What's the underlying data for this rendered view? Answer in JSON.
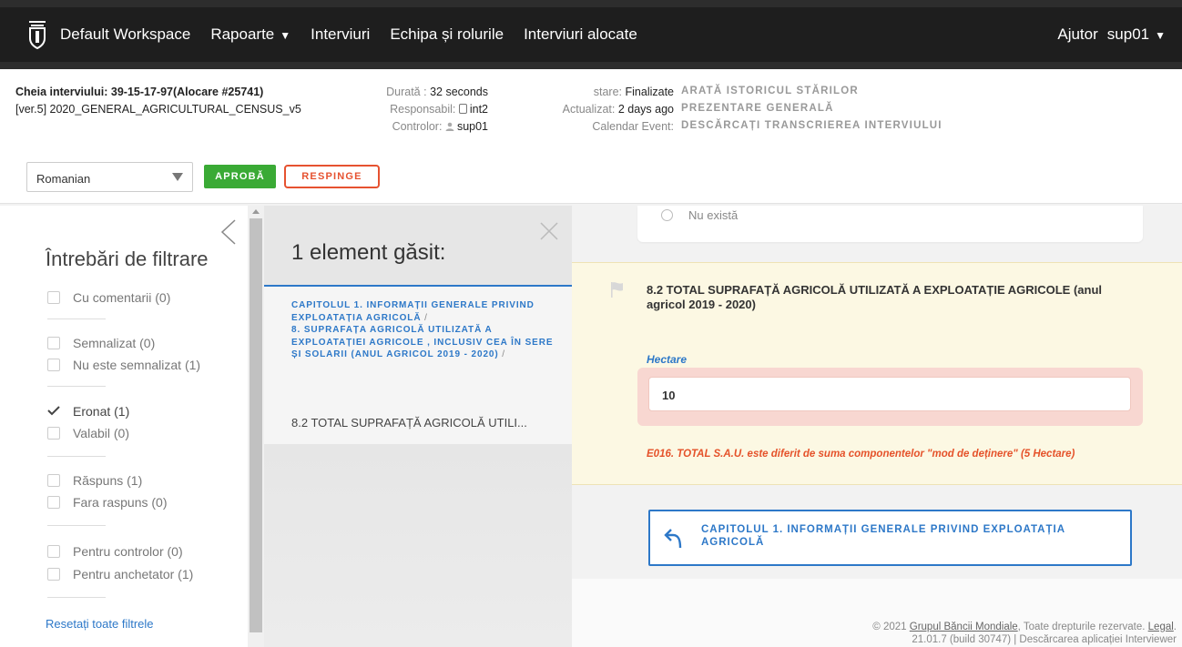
{
  "nav": {
    "workspace": "Default Workspace",
    "reports": "Rapoarte",
    "interviews": "Interviuri",
    "team": "Echipa și rolurile",
    "assigned": "Interviuri alocate",
    "help": "Ajutor",
    "user": "sup01"
  },
  "interview": {
    "key_label": "Cheia interviului: 39-15-17-97(Alocare #25741)",
    "questionnaire": "[ver.5] 2020_GENERAL_AGRICULTURAL_CENSUS_v5",
    "duration_label": "Durată :",
    "duration_value": "32 seconds",
    "responsible_label": "Responsabil:",
    "responsible_value": "int2",
    "supervisor_label": "Controlor:",
    "supervisor_value": "sup01",
    "status_label": "stare:",
    "status_value": "Finalizate",
    "updated_label": "Actualizat:",
    "updated_value": "2 days ago",
    "calendar_label": "Calendar Event:",
    "link_history": "ARATĂ ISTORICUL STĂRILOR",
    "link_overview": "PREZENTARE GENERALĂ",
    "link_transcript": "DESCĂRCAȚI TRANSCRIEREA INTERVIULUI",
    "language": "Romanian",
    "approve": "APROBĂ",
    "reject": "RESPINGE"
  },
  "filters": {
    "title": "Întrebări de filtrare",
    "items": [
      {
        "label": "Cu comentarii (0)",
        "checked": false
      },
      {
        "label": "Semnalizat (0)",
        "checked": false
      },
      {
        "label": "Nu este semnalizat (1)",
        "checked": false
      },
      {
        "label": "Eronat (1)",
        "checked": true
      },
      {
        "label": "Valabil (0)",
        "checked": false
      },
      {
        "label": "Răspuns (1)",
        "checked": false
      },
      {
        "label": "Fara raspuns (0)",
        "checked": false
      },
      {
        "label": "Pentru controlor (0)",
        "checked": false
      },
      {
        "label": "Pentru anchetator (1)",
        "checked": false
      }
    ],
    "reset": "Resetați toate filtrele"
  },
  "results": {
    "title": "1 element găsit:",
    "crumb1": "CAPITOLUL 1. INFORMAȚII GENERALE PRIVIND EXPLOATAȚIA AGRICOLĂ",
    "crumb2": "8. SUPRAFAȚA AGRICOLĂ UTILIZATĂ A EXPLOATAȚIEI AGRICOLE , INCLUSIV CEA ÎN SERE ȘI SOLARII (ANUL AGRICOL 2019 - 2020)",
    "crumb_sep": "/",
    "question": "8.2 TOTAL SUPRAFAȚĂ AGRICOLĂ UTILI..."
  },
  "main": {
    "option_label": "Nu există",
    "question_title": "8.2 TOTAL SUPRAFAȚĂ AGRICOLĂ UTILIZATĂ A EXPLOATAȚIE AGRICOLE (anul agricol 2019 - 2020)",
    "hint": "Hectare",
    "answer": "10",
    "error": "E016. TOTAL S.A.U. este diferit de suma componentelor \"mod de deținere\" (5 Hectare)",
    "chapter_link": "CAPITOLUL 1. INFORMAȚII GENERALE PRIVIND EXPLOATAȚIA AGRICOLĂ"
  },
  "footer": {
    "copyright_prefix": "© 2021",
    "org": "Grupul Băncii Mondiale",
    "rights": ", Toate drepturile rezervate.",
    "legal": "Legal",
    "legal_suffix": ".",
    "version": "21.01.7 (build 30747) | Descărcarea aplicației Interviewer"
  },
  "colors": {
    "accent": "#2d78c8",
    "approve": "#3aaa35",
    "reject": "#e65230",
    "error": "#e5522a"
  }
}
